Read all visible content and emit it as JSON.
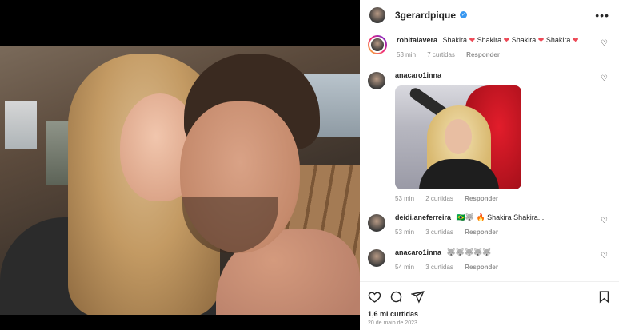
{
  "post": {
    "author": "3gerardpique",
    "more_icon": "more-horizontal-icon",
    "likes_label": "1,6 mi curtidas",
    "date": "20 de maio de 2023"
  },
  "comments": [
    {
      "user": "robitalavera",
      "text_parts": [
        "Shakira",
        "Shakira",
        "Shakira",
        "Shakira"
      ],
      "text_icon": "pink-heart-icon",
      "time": "53 min",
      "likes": "7 curtidas",
      "reply": "Responder"
    },
    {
      "user": "anacaro1inna",
      "text": "",
      "time": "53 min",
      "likes": "2 curtidas",
      "reply": "Responder"
    },
    {
      "user": "deidi.aneferreira",
      "text": "🇧🇷🐺 🔥 Shakira Shakira...",
      "time": "53 min",
      "likes": "3 curtidas",
      "reply": "Responder"
    },
    {
      "user": "anacaro1inna",
      "text": "🐺🐺🐺🐺🐺",
      "time": "54 min",
      "likes": "3 curtidas",
      "reply": "Responder"
    }
  ],
  "colors": {
    "verified": "#3897f0",
    "heart": "#ed4956",
    "meta_gray": "#8e8e8e"
  }
}
